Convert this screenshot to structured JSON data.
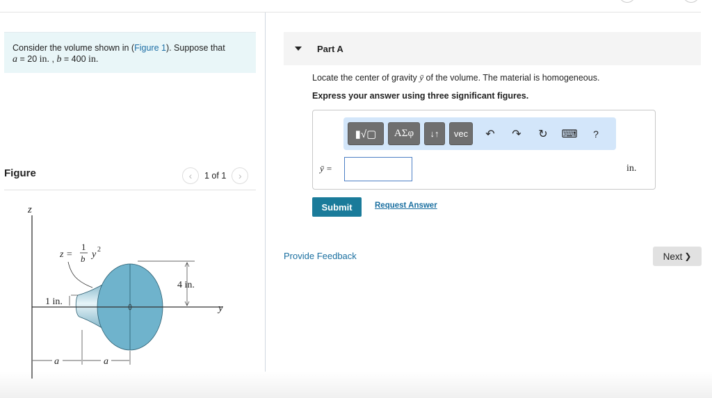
{
  "problem": {
    "intro": "Consider the volume shown in (",
    "figure_link": "Figure 1",
    "intro_end": "). Suppose that",
    "a_var": "a",
    "a_value": " = 20 ",
    "a_unit": "in.",
    "separator": " , ",
    "b_var": "b",
    "b_value": " = 400 ",
    "b_unit": "in."
  },
  "figure": {
    "title": "Figure",
    "pager": "1 of 1",
    "prev_icon": "‹",
    "next_icon": "›",
    "labels": {
      "z_axis": "z",
      "y_axis": "y",
      "equation_lhs": "z =",
      "equation_num": "1",
      "equation_den": "b",
      "equation_rhs": "y",
      "equation_exp": "2",
      "small_radius": "1 in.",
      "large_radius": "4 in.",
      "dim_a1": "a",
      "dim_a2": "a"
    },
    "colors": {
      "solid": "#6fb3cc",
      "solid_dark": "#3d8aa8",
      "line": "#333333"
    }
  },
  "part": {
    "label": "Part A",
    "question_pre": "Locate the center of gravity ",
    "question_var": "ȳ",
    "question_post": " of the volume. The material is homogeneous.",
    "instruction": "Express your answer using three significant figures."
  },
  "toolbar": {
    "templates_label": "▮√▢",
    "greek_label": "ΑΣφ",
    "arrows_label": "↓↑",
    "vec_label": "vec",
    "undo_icon": "↶",
    "redo_icon": "↷",
    "reset_icon": "↻",
    "keyboard_icon": "⌨",
    "help_icon": "?"
  },
  "answer": {
    "variable": "ȳ =",
    "value": "",
    "placeholder": "",
    "unit": "in."
  },
  "actions": {
    "submit": "Submit",
    "request_answer": "Request Answer",
    "feedback": "Provide Feedback",
    "next": "Next",
    "next_icon": "❯"
  },
  "colors": {
    "accent": "#1a7b9a",
    "link": "#1a6fa0",
    "toolbar_bg": "#d3e6fa",
    "problem_bg": "#e9f6f8"
  }
}
